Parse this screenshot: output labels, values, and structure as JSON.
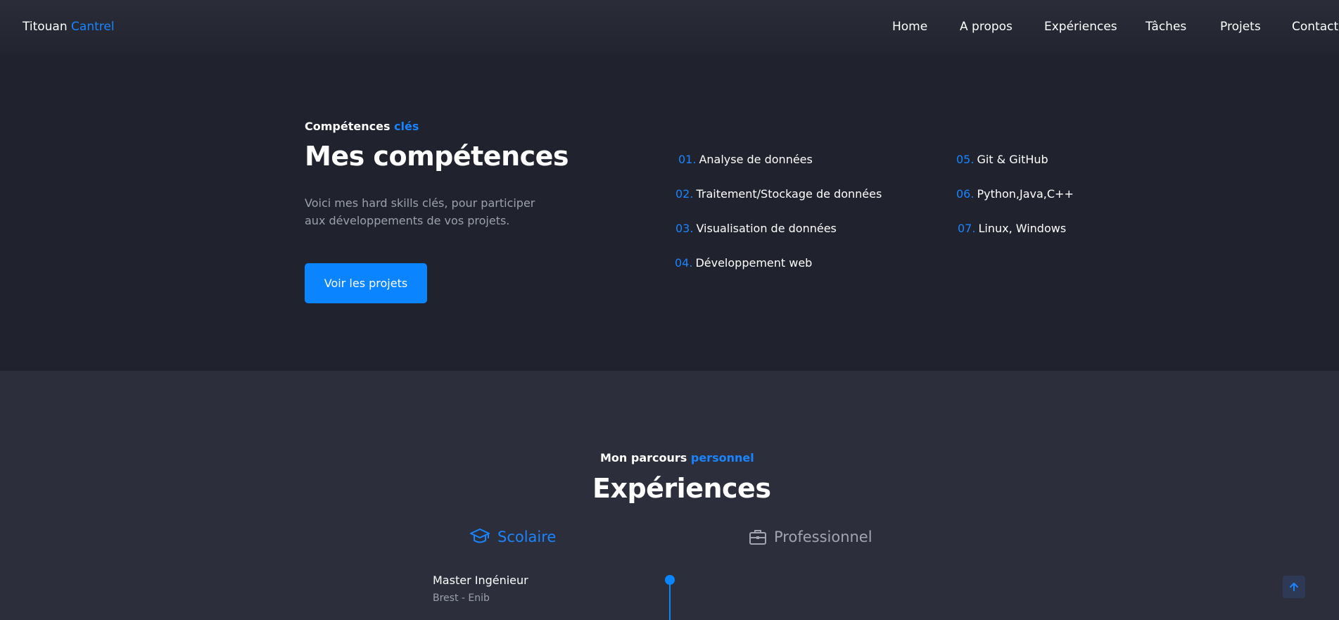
{
  "navbar": {
    "brand_first": "Titouan",
    "brand_last": "Cantrel",
    "links": [
      "Home",
      "A propos",
      "Expériences",
      "Tâches",
      "Projets",
      "Contact"
    ]
  },
  "skills": {
    "eyebrow_main": "Compétences",
    "eyebrow_accent": "clés",
    "title": "Mes compétences",
    "lead_line1": "Voici mes hard skills clés, pour participer",
    "lead_line2": "aux développements de vos projets.",
    "cta_label": "Voir les projets",
    "items": [
      {
        "num": "01.",
        "label": "Analyse de données"
      },
      {
        "num": "02.",
        "label": "Traitement/Stockage de données"
      },
      {
        "num": "03.",
        "label": "Visualisation de données"
      },
      {
        "num": "04.",
        "label": "Développement web"
      },
      {
        "num": "05.",
        "label": "Git & GitHub"
      },
      {
        "num": "06.",
        "label": "Python,Java,C++"
      },
      {
        "num": "07.",
        "label": "Linux, Windows"
      }
    ]
  },
  "experiences": {
    "eyebrow_main": "Mon parcours",
    "eyebrow_accent": "personnel",
    "title": "Expériences",
    "tabs": [
      {
        "label": "Scolaire",
        "icon": "graduation-cap-icon",
        "active": true
      },
      {
        "label": "Professionnel",
        "icon": "briefcase-icon",
        "active": false
      }
    ],
    "entries": [
      {
        "title": "Master Ingénieur",
        "subtitle": "Brest - Enib"
      }
    ]
  },
  "colors": {
    "accent": "#0a84ff",
    "background": "#20232d",
    "section_alt": "#2c2f3b"
  },
  "scroll_top": {
    "icon": "arrow-up-icon"
  }
}
